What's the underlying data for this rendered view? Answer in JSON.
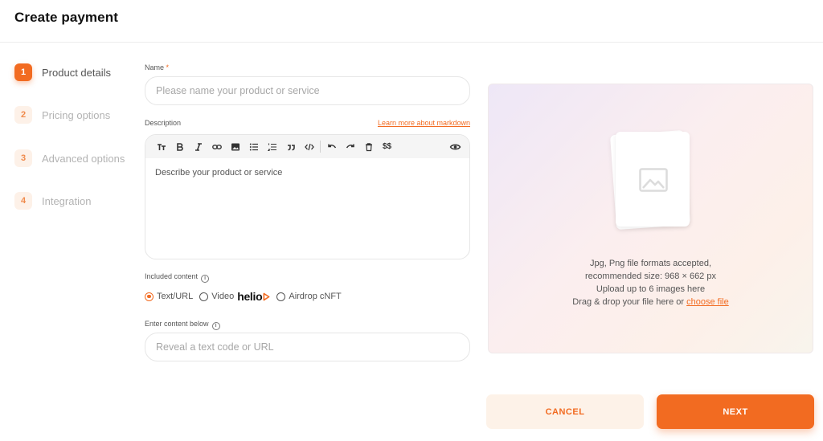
{
  "page": {
    "title": "Create payment"
  },
  "steps": [
    {
      "number": "1",
      "label": "Product details",
      "active": true
    },
    {
      "number": "2",
      "label": "Pricing options",
      "active": false
    },
    {
      "number": "3",
      "label": "Advanced options",
      "active": false
    },
    {
      "number": "4",
      "label": "Integration",
      "active": false
    }
  ],
  "form": {
    "name": {
      "label": "Name",
      "required_mark": "*",
      "placeholder": "Please name your product or service",
      "value": ""
    },
    "description": {
      "label": "Description",
      "markdown_link": "Learn more about markdown",
      "placeholder": "Describe your product or service",
      "toolbar": [
        "text-size-icon",
        "bold-icon",
        "italic-icon",
        "link-icon",
        "image-icon",
        "bullet-list-icon",
        "numbered-list-icon",
        "quote-icon",
        "code-icon",
        "undo-icon",
        "redo-icon",
        "clear-icon",
        "math-icon",
        "preview-icon"
      ],
      "math_label": "$$"
    },
    "included_content": {
      "label": "Included content",
      "options": [
        {
          "label": "Text/URL",
          "selected": true
        },
        {
          "label": "Video",
          "selected": false
        },
        {
          "label": "Airdrop cNFT",
          "selected": false
        }
      ],
      "brand_text": "helio"
    },
    "content": {
      "label": "Enter content below",
      "placeholder": "Reveal a text code or URL",
      "value": ""
    }
  },
  "upload": {
    "line1": "Jpg, Png file formats accepted,",
    "line2": "recommended size: 968 × 662 px",
    "line3": "Upload up to 6 images here",
    "line4_prefix": "Drag & drop your file here or",
    "line4_link": "choose file"
  },
  "buttons": {
    "cancel": "CANCEL",
    "next": "NEXT"
  },
  "colors": {
    "accent": "#f26b21",
    "accent_light": "#fdf2e8"
  }
}
